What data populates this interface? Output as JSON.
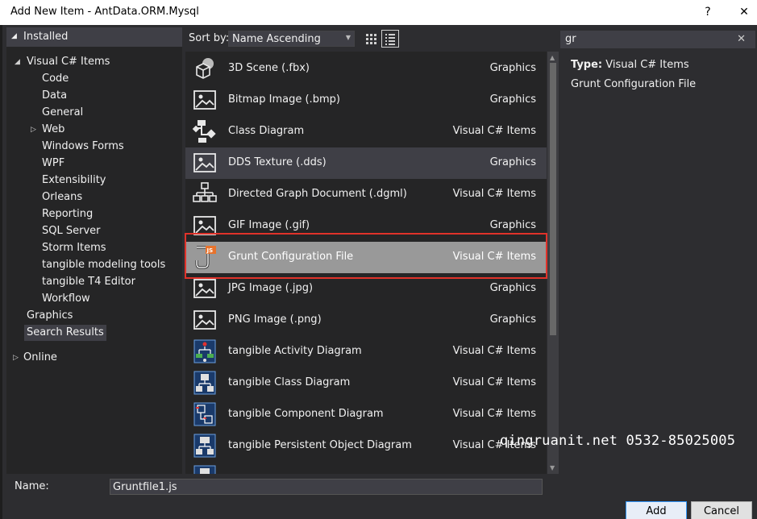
{
  "window": {
    "title": "Add New Item - AntData.ORM.Mysql",
    "help_glyph": "?",
    "close_glyph": "✕"
  },
  "tree": {
    "installed": "Installed",
    "visual_csharp": "Visual C# Items",
    "children": [
      "Code",
      "Data",
      "General",
      "Web",
      "Windows Forms",
      "WPF",
      "Extensibility",
      "Orleans",
      "Reporting",
      "SQL Server",
      "Storm Items",
      "tangible modeling tools",
      "tangible T4 Editor",
      "Workflow"
    ],
    "graphics": "Graphics",
    "search_results": "Search Results",
    "online": "Online"
  },
  "toolbar": {
    "sort_label": "Sort by:",
    "sort_value": "Name Ascending"
  },
  "search": {
    "query": "gr",
    "clear_glyph": "✕"
  },
  "templates": [
    {
      "name": "3D Scene (.fbx)",
      "type": "Graphics",
      "icon": "3d-scene-icon"
    },
    {
      "name": "Bitmap Image (.bmp)",
      "type": "Graphics",
      "icon": "image-icon"
    },
    {
      "name": "Class Diagram",
      "type": "Visual C# Items",
      "icon": "class-diagram-icon"
    },
    {
      "name": "DDS Texture (.dds)",
      "type": "Graphics",
      "icon": "image-icon"
    },
    {
      "name": "Directed Graph Document (.dgml)",
      "type": "Visual C# Items",
      "icon": "graph-icon"
    },
    {
      "name": "GIF Image (.gif)",
      "type": "Graphics",
      "icon": "image-icon"
    },
    {
      "name": "Grunt Configuration File",
      "type": "Visual C# Items",
      "icon": "grunt-js-icon"
    },
    {
      "name": "JPG Image (.jpg)",
      "type": "Graphics",
      "icon": "image-icon"
    },
    {
      "name": "PNG Image (.png)",
      "type": "Graphics",
      "icon": "image-icon"
    },
    {
      "name": "tangible Activity Diagram",
      "type": "Visual C# Items",
      "icon": "activity-diagram-icon"
    },
    {
      "name": "tangible Class Diagram",
      "type": "Visual C# Items",
      "icon": "tangible-class-diagram-icon"
    },
    {
      "name": "tangible Component Diagram",
      "type": "Visual C# Items",
      "icon": "component-diagram-icon"
    },
    {
      "name": "tangible Persistent Object Diagram",
      "type": "Visual C# Items",
      "icon": "persistent-object-diagram-icon"
    }
  ],
  "details": {
    "type_label": "Type:",
    "type_value": "Visual C# Items",
    "description": "Grunt Configuration File"
  },
  "watermark": "qingruanit.net 0532-85025005",
  "footer": {
    "name_label": "Name:",
    "name_value": "Gruntfile1.js",
    "add_label": "Add",
    "cancel_label": "Cancel"
  },
  "colors": {
    "background": "#2d2d30",
    "panel": "#252526",
    "selected_row": "#999999",
    "highlight_border": "#e0322a",
    "accent": "#3399ff"
  }
}
